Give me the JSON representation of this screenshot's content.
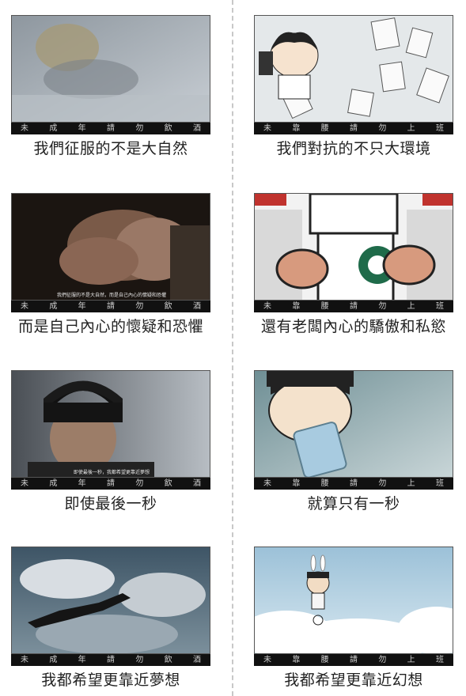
{
  "left_bar": [
    "未",
    "成",
    "年",
    "請",
    "勿",
    "飲",
    "酒"
  ],
  "right_bar": [
    "未",
    "靠",
    "腰",
    "請",
    "勿",
    "上",
    "班"
  ],
  "panels": [
    {
      "caption": "我們征服的不是大自然"
    },
    {
      "caption": "我們對抗的不只大環境"
    },
    {
      "caption": "而是自己內心的懷疑和恐懼",
      "subtitle": "我們征服的不是大自然，而是自己內心的懷疑和恐懼"
    },
    {
      "caption": "還有老闆內心的驕傲和私慾"
    },
    {
      "caption": "即使最後一秒",
      "subtitle": "即使最後一秒，我都希望更靠近夢想"
    },
    {
      "caption": "就算只有一秒"
    },
    {
      "caption": "我都希望更靠近夢想"
    },
    {
      "caption": "我都希望更靠近幻想"
    }
  ]
}
